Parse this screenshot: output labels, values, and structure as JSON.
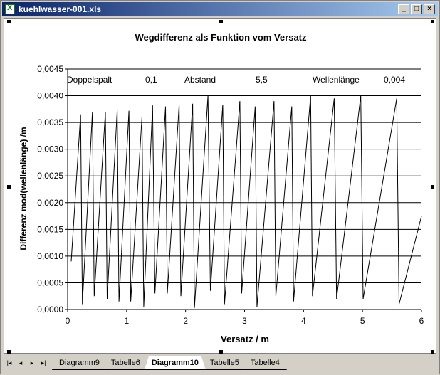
{
  "window": {
    "title": "kuehlwasser-001.xls",
    "buttons": [
      "minimize-icon",
      "maximize-icon",
      "close-icon"
    ]
  },
  "chart_data": {
    "type": "line",
    "title": "Wegdifferenz als Funktion vom Versatz",
    "xlabel": "Versatz / m",
    "ylabel": "Differenz mod(wellenlänge) /m",
    "xlim": [
      0,
      6
    ],
    "ylim": [
      0,
      0.0045
    ],
    "x_ticks": [
      "0",
      "1",
      "2",
      "3",
      "4",
      "5",
      "6"
    ],
    "y_ticks": [
      "0,0000",
      "0,0005",
      "0,0010",
      "0,0015",
      "0,0020",
      "0,0025",
      "0,0030",
      "0,0035",
      "0,0040",
      "0,0045"
    ],
    "grid": "horizontal",
    "annotations": [
      {
        "label": "Doppelspalt",
        "value": "0,1"
      },
      {
        "label": "Abstand",
        "value": "5,5"
      },
      {
        "label": "Wellenlänge",
        "value": "0,004"
      }
    ],
    "series": [
      {
        "points": [
          [
            0.06,
            0.0009
          ],
          [
            0.22,
            0.00365
          ],
          [
            0.25,
            0.0001
          ],
          [
            0.42,
            0.0037
          ],
          [
            0.45,
            0.00025
          ],
          [
            0.64,
            0.0037
          ],
          [
            0.67,
            0.0002
          ],
          [
            0.84,
            0.00373
          ],
          [
            0.87,
            0.00015
          ],
          [
            1.04,
            0.00372
          ],
          [
            1.07,
            0.00015
          ],
          [
            1.26,
            0.0036
          ],
          [
            1.29,
            5e-05
          ],
          [
            1.44,
            0.00382
          ],
          [
            1.48,
            0.0003
          ],
          [
            1.66,
            0.0038
          ],
          [
            1.69,
            0.0003
          ],
          [
            1.89,
            0.00383
          ],
          [
            1.92,
            0.00025
          ],
          [
            2.12,
            0.00385
          ],
          [
            2.15,
            3e-05
          ],
          [
            2.38,
            0.004
          ],
          [
            2.42,
            0.00035
          ],
          [
            2.63,
            0.00383
          ],
          [
            2.66,
            0.0001
          ],
          [
            2.92,
            0.0039
          ],
          [
            2.95,
            0.0003
          ],
          [
            3.18,
            0.0038
          ],
          [
            3.21,
            5e-05
          ],
          [
            3.5,
            0.0039
          ],
          [
            3.53,
            0.00025
          ],
          [
            3.8,
            0.0038
          ],
          [
            3.83,
            0.00015
          ],
          [
            4.12,
            0.004
          ],
          [
            4.15,
            0.00025
          ],
          [
            4.52,
            0.00395
          ],
          [
            4.56,
            0.0002
          ],
          [
            4.97,
            0.004
          ],
          [
            5.01,
            0.0002
          ],
          [
            5.58,
            0.00395
          ],
          [
            5.62,
            0.0001
          ],
          [
            6.0,
            0.00175
          ]
        ]
      }
    ]
  },
  "sheet_tabs": {
    "nav": [
      "first-sheet-icon",
      "prev-sheet-icon",
      "next-sheet-icon",
      "last-sheet-icon"
    ],
    "nav_glyphs": [
      "|◂",
      "◂",
      "▸",
      "▸|"
    ],
    "items": [
      "Diagramm9",
      "Tabelle6",
      "Diagramm10",
      "Tabelle5",
      "Tabelle4"
    ],
    "active": "Diagramm10"
  }
}
